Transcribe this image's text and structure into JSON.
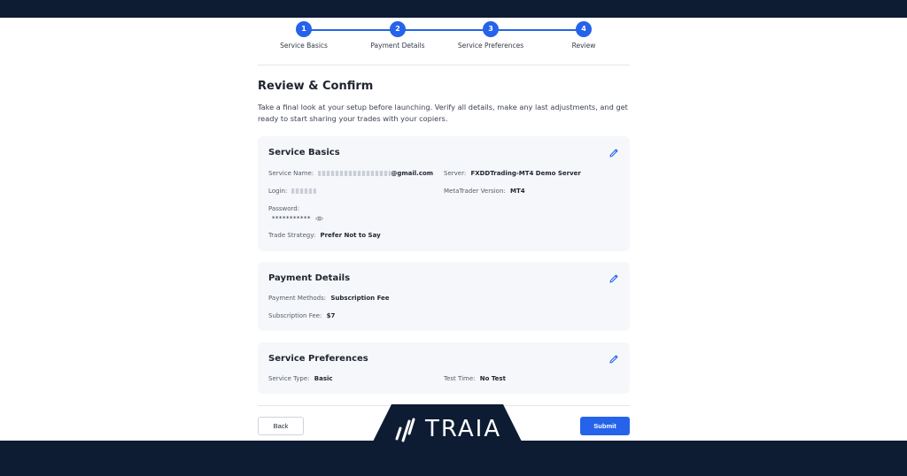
{
  "stepper": {
    "steps": [
      {
        "number": "1",
        "label": "Service Basics"
      },
      {
        "number": "2",
        "label": "Payment Details"
      },
      {
        "number": "3",
        "label": "Service Preferences"
      },
      {
        "number": "4",
        "label": "Review"
      }
    ]
  },
  "page": {
    "title": "Review & Confirm",
    "description": "Take a final look at your setup before launching. Verify all details, make any last adjustments, and get ready to start sharing your trades with your copiers."
  },
  "service_basics": {
    "title": "Service Basics",
    "service_name_label": "Service Name:",
    "service_name_value": "@gmail.com",
    "server_label": "Server:",
    "server_value": "FXDDTrading-MT4 Demo Server",
    "login_label": "Login:",
    "metatrader_label": "MetaTrader Version:",
    "metatrader_value": "MT4",
    "password_label": "Password:",
    "password_value": "***********",
    "strategy_label": "Trade Strategy:",
    "strategy_value": "Prefer Not to Say"
  },
  "payment_details": {
    "title": "Payment Details",
    "methods_label": "Payment Methods:",
    "methods_value": "Subscription Fee",
    "fee_label": "Subscription Fee:",
    "fee_value": "$7"
  },
  "service_preferences": {
    "title": "Service Preferences",
    "type_label": "Service Type:",
    "type_value": "Basic",
    "test_label": "Test Time:",
    "test_value": "No Test"
  },
  "actions": {
    "back_label": "Back",
    "submit_label": "Submit"
  },
  "brand": {
    "name": "TRAIA",
    "accent": "#2563eb",
    "navy": "#0d1b33"
  }
}
